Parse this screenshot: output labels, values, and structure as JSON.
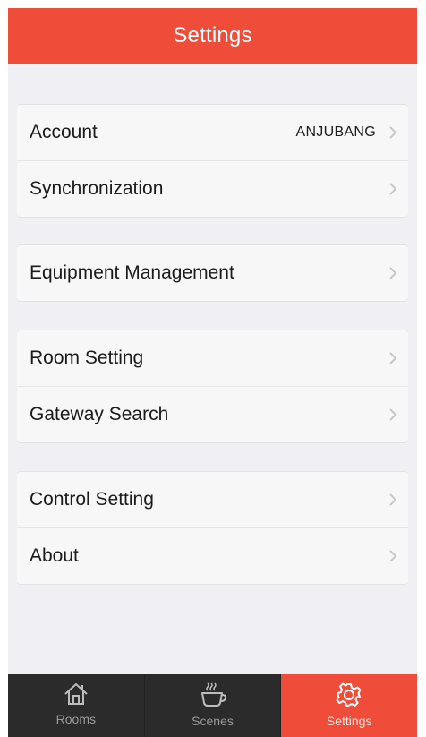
{
  "header": {
    "title": "Settings"
  },
  "groups": [
    {
      "rows": [
        {
          "label": "Account",
          "value": "ANJUBANG"
        },
        {
          "label": "Synchronization"
        }
      ]
    },
    {
      "rows": [
        {
          "label": "Equipment Management"
        }
      ]
    },
    {
      "rows": [
        {
          "label": "Room Setting"
        },
        {
          "label": "Gateway Search"
        }
      ]
    },
    {
      "rows": [
        {
          "label": "Control Setting"
        },
        {
          "label": "About"
        }
      ]
    }
  ],
  "tabbar": {
    "tabs": [
      {
        "label": "Rooms",
        "icon": "home-icon",
        "active": false
      },
      {
        "label": "Scenes",
        "icon": "coffee-cup-icon",
        "active": false
      },
      {
        "label": "Settings",
        "icon": "gear-icon",
        "active": true
      }
    ]
  },
  "colors": {
    "accent": "#ef4d3a",
    "tabbar_bg": "#2b2b2b",
    "page_bg": "#efeff4"
  }
}
